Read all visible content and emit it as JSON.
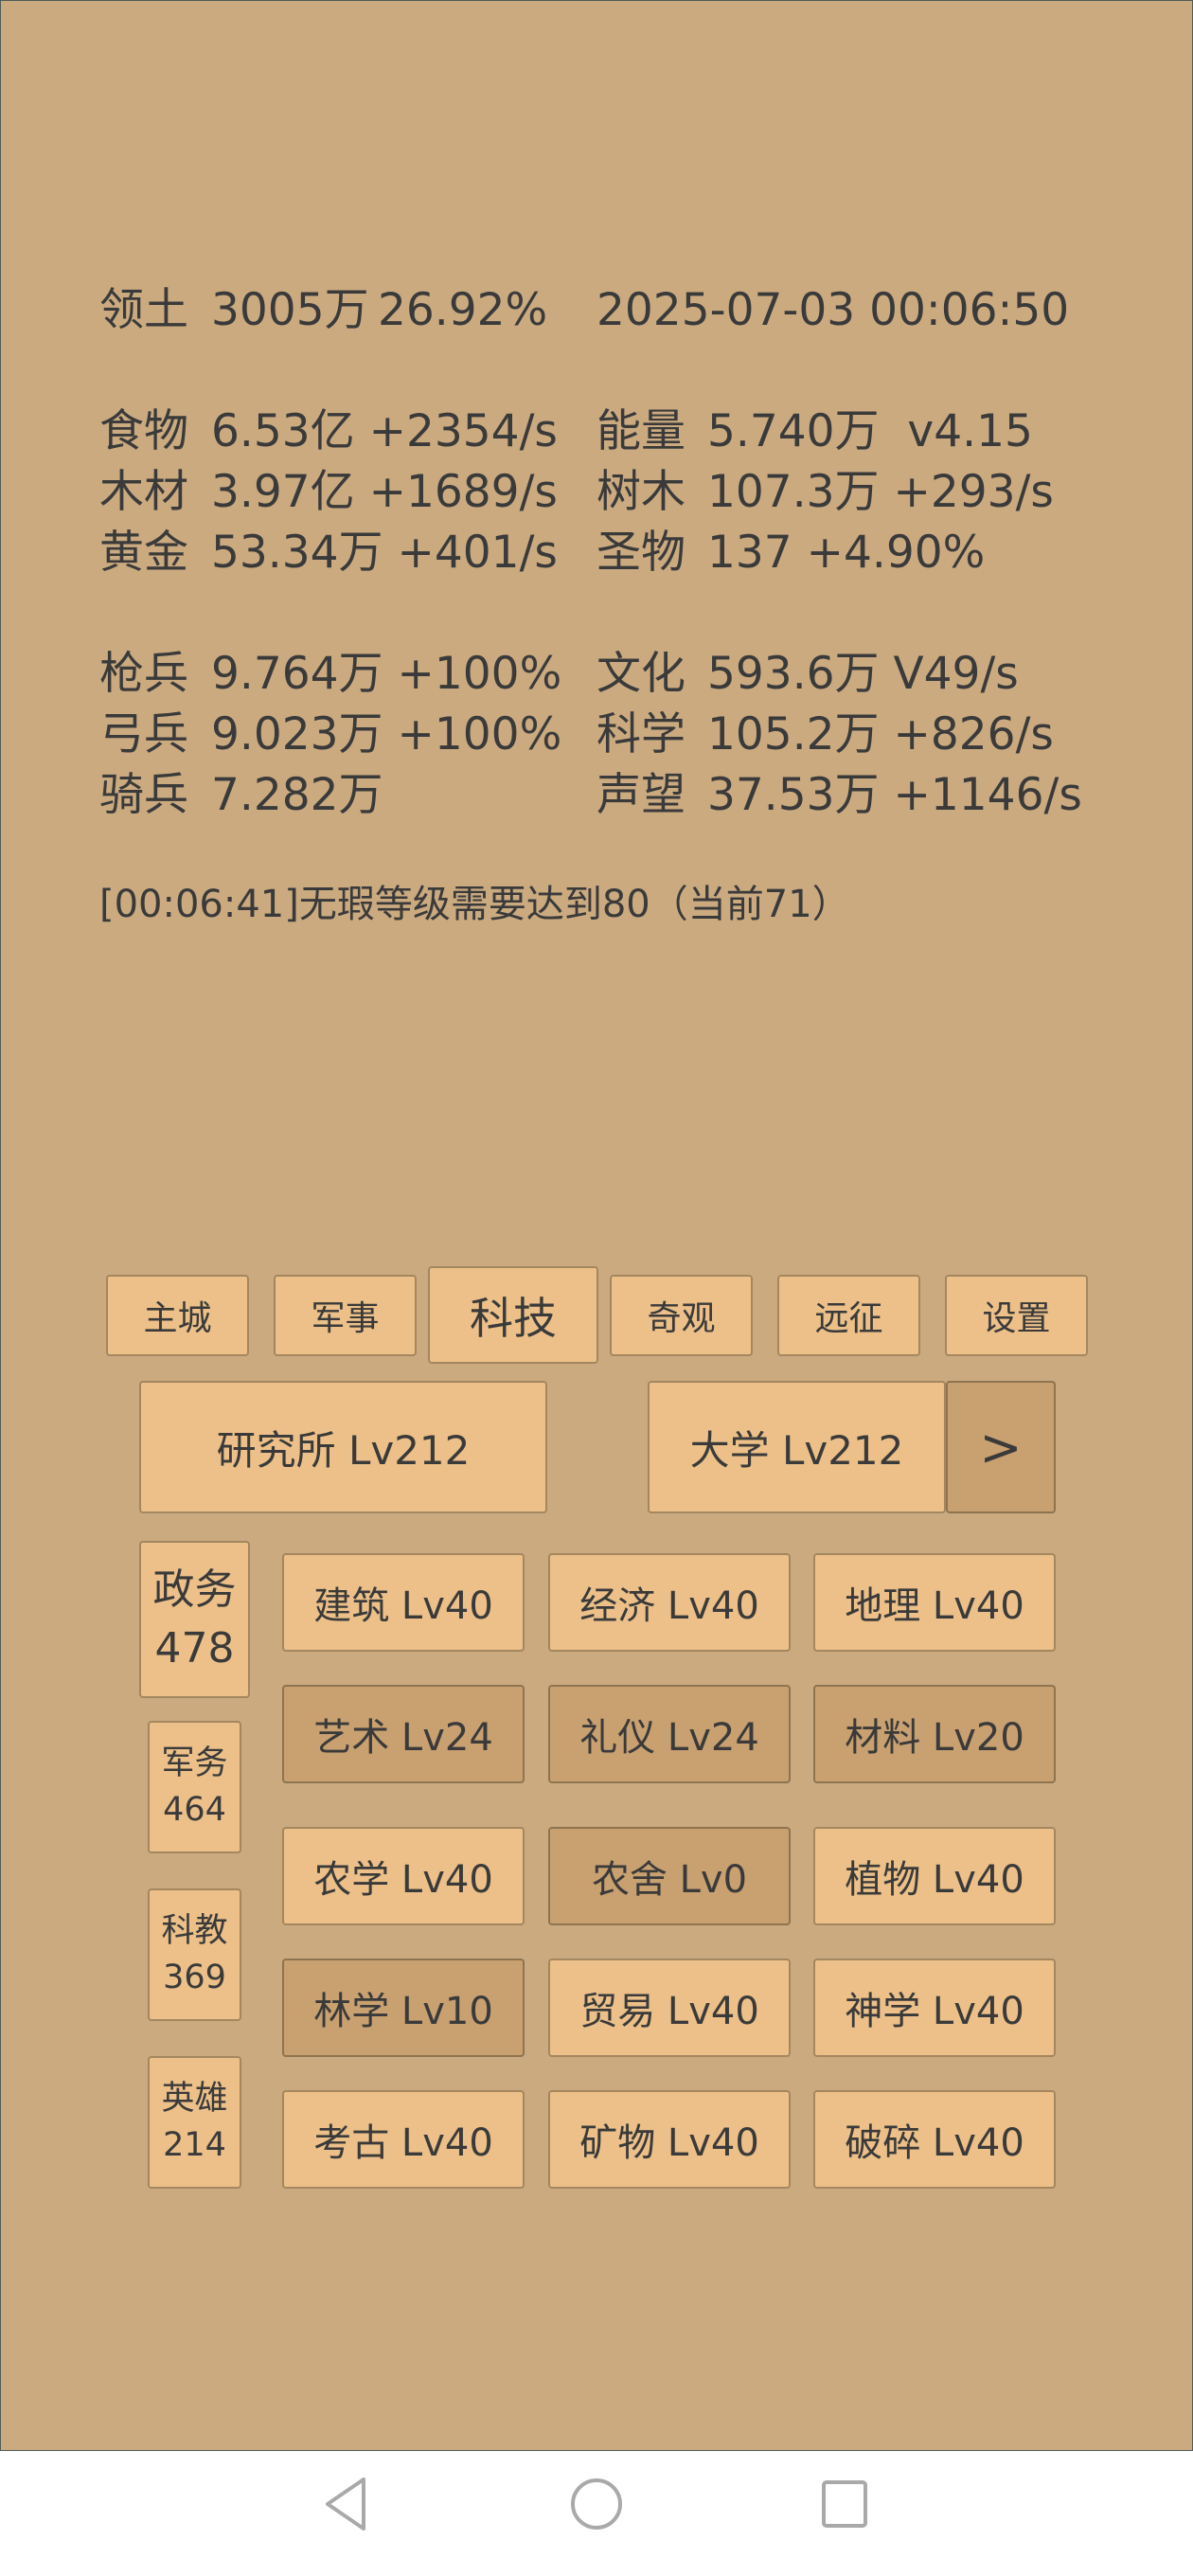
{
  "status": {
    "territory_label": "领土",
    "territory_value": "3005万",
    "territory_pct": "26.92%",
    "datetime": "2025-07-03 00:06:50"
  },
  "resources": [
    {
      "label": "食物",
      "value": "6.53亿 +2354/s"
    },
    {
      "label": "能量",
      "value": "5.740万  v4.15"
    },
    {
      "label": "木材",
      "value": "3.97亿 +1689/s"
    },
    {
      "label": "树木",
      "value": "107.3万 +293/s"
    },
    {
      "label": "黄金",
      "value": "53.34万 +401/s"
    },
    {
      "label": "圣物",
      "value": "137 +4.90%"
    },
    {
      "label": "枪兵",
      "value": "9.764万 +100%"
    },
    {
      "label": "文化",
      "value": "593.6万 V49/s"
    },
    {
      "label": "弓兵",
      "value": "9.023万 +100%"
    },
    {
      "label": "科学",
      "value": "105.2万 +826/s"
    },
    {
      "label": "骑兵",
      "value": "7.282万"
    },
    {
      "label": "声望",
      "value": "37.53万 +1146/s"
    }
  ],
  "log": "[00:06:41]无瑕等级需要达到80（当前71）",
  "tabs": [
    "主城",
    "军事",
    "科技",
    "奇观",
    "远征",
    "设置"
  ],
  "active_tab": "科技",
  "subnav": {
    "research": "研究所 Lv212",
    "university": "大学 Lv212",
    "next": ">"
  },
  "side": [
    {
      "name": "政务",
      "count": "478"
    },
    {
      "name": "军务",
      "count": "464"
    },
    {
      "name": "科教",
      "count": "369"
    },
    {
      "name": "英雄",
      "count": "214"
    }
  ],
  "techs": [
    "建筑 Lv40",
    "经济 Lv40",
    "地理 Lv40",
    "艺术 Lv24",
    "礼仪 Lv24",
    "材料 Lv20",
    "农学 Lv40",
    "农舍 Lv0",
    "植物 Lv40",
    "林学 Lv10",
    "贸易 Lv40",
    "神学 Lv40",
    "考古 Lv40",
    "矿物 Lv40",
    "破碎 Lv40"
  ],
  "colors": {
    "background": "#cbaa80",
    "button": "#ecc088",
    "button_dark": "#c9a070",
    "text": "#3a3a3a"
  },
  "icons": {
    "nav_back": "triangle-back-icon",
    "nav_home": "circle-home-icon",
    "nav_recent": "square-recent-icon"
  }
}
